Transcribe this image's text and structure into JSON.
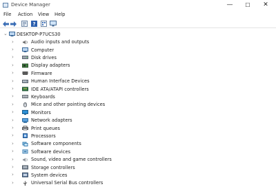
{
  "window": {
    "title": "Device Manager",
    "controls": [
      "—",
      "☐",
      "✕"
    ]
  },
  "menu": [
    "File",
    "Action",
    "View",
    "Help"
  ],
  "tree": {
    "root": "DESKTOP-P7UCS30",
    "items": [
      {
        "label": "Audio inputs and outputs",
        "icon": "speaker-icon"
      },
      {
        "label": "Computer",
        "icon": "computer-icon"
      },
      {
        "label": "Disk drives",
        "icon": "disk-drive-icon"
      },
      {
        "label": "Display adapters",
        "icon": "display-adapter-icon"
      },
      {
        "label": "Firmware",
        "icon": "firmware-icon"
      },
      {
        "label": "Human Interface Devices",
        "icon": "hid-icon"
      },
      {
        "label": "IDE ATA/ATAPI controllers",
        "icon": "ide-controller-icon"
      },
      {
        "label": "Keyboards",
        "icon": "keyboard-icon"
      },
      {
        "label": "Mice and other pointing devices",
        "icon": "mouse-icon"
      },
      {
        "label": "Monitors",
        "icon": "monitor-icon"
      },
      {
        "label": "Network adapters",
        "icon": "network-adapter-icon"
      },
      {
        "label": "Print queues",
        "icon": "printer-icon"
      },
      {
        "label": "Processors",
        "icon": "processor-icon"
      },
      {
        "label": "Software components",
        "icon": "software-component-icon"
      },
      {
        "label": "Software devices",
        "icon": "software-device-icon"
      },
      {
        "label": "Sound, video and game controllers",
        "icon": "sound-controller-icon"
      },
      {
        "label": "Storage controllers",
        "icon": "storage-controller-icon"
      },
      {
        "label": "System devices",
        "icon": "system-device-icon"
      },
      {
        "label": "Universal Serial Bus controllers",
        "icon": "usb-icon"
      }
    ]
  }
}
